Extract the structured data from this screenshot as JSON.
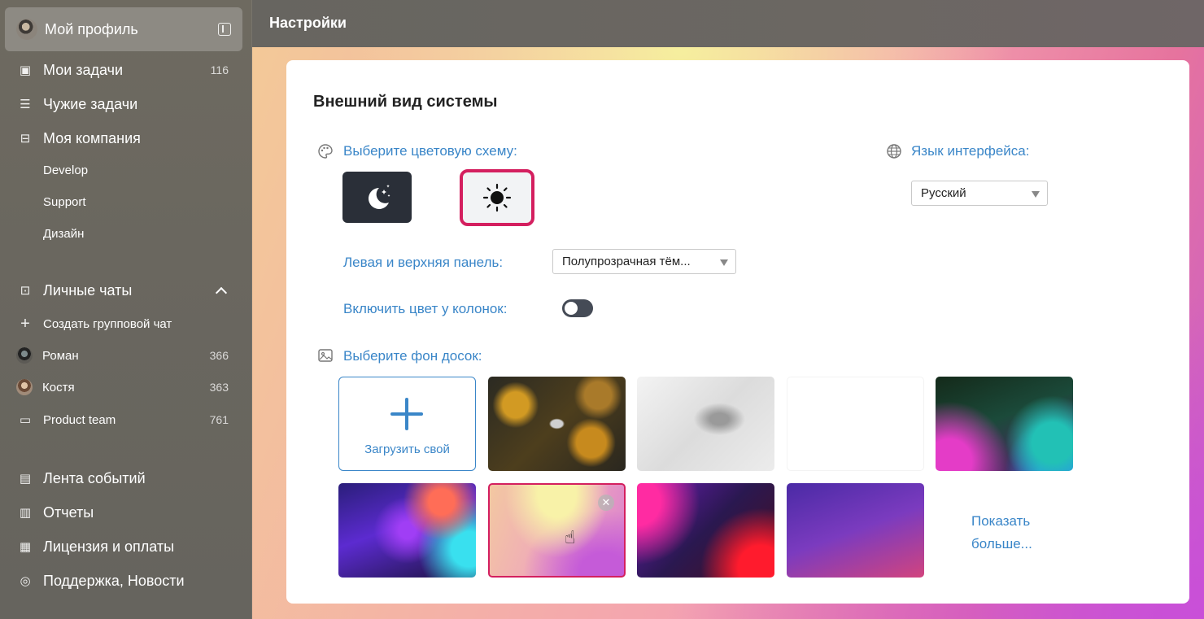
{
  "topbar": {
    "title": "Настройки"
  },
  "sidebar": {
    "profile": {
      "name": "Мой профиль"
    },
    "items": [
      {
        "label": "Мои задачи",
        "count": "116",
        "icon": "tasks-icon"
      },
      {
        "label": "Чужие задачи",
        "icon": "list-icon"
      },
      {
        "label": "Моя компания",
        "icon": "briefcase-icon"
      }
    ],
    "company_sub": [
      "Develop",
      "Support",
      "Дизайн"
    ],
    "chats": {
      "header": "Личные чаты",
      "create": "Создать групповой чат",
      "list": [
        {
          "label": "Роман",
          "count": "366"
        },
        {
          "label": "Костя",
          "count": "363"
        },
        {
          "label": "Product team",
          "count": "761"
        }
      ]
    },
    "bottom": [
      {
        "label": "Лента событий",
        "icon": "feed-icon"
      },
      {
        "label": "Отчеты",
        "icon": "reports-icon"
      },
      {
        "label": "Лицензия и оплаты",
        "icon": "license-icon"
      },
      {
        "label": "Поддержка, Новости",
        "icon": "support-icon"
      }
    ]
  },
  "settings": {
    "section_title": "Внешний вид системы",
    "color_scheme_label": "Выберите цветовую схему:",
    "language_label": "Язык интерфейса:",
    "language_value": "Русский",
    "panel_label": "Левая и верхняя панель:",
    "panel_value": "Полупрозрачная тём...",
    "column_color_label": "Включить цвет у колонок:",
    "column_color_on": false,
    "background_label": "Выберите фон досок:",
    "upload_label": "Загрузить свой",
    "show_more": "Показать больше...",
    "accent_color": "#d41f5f",
    "link_color": "#3a86c8"
  }
}
